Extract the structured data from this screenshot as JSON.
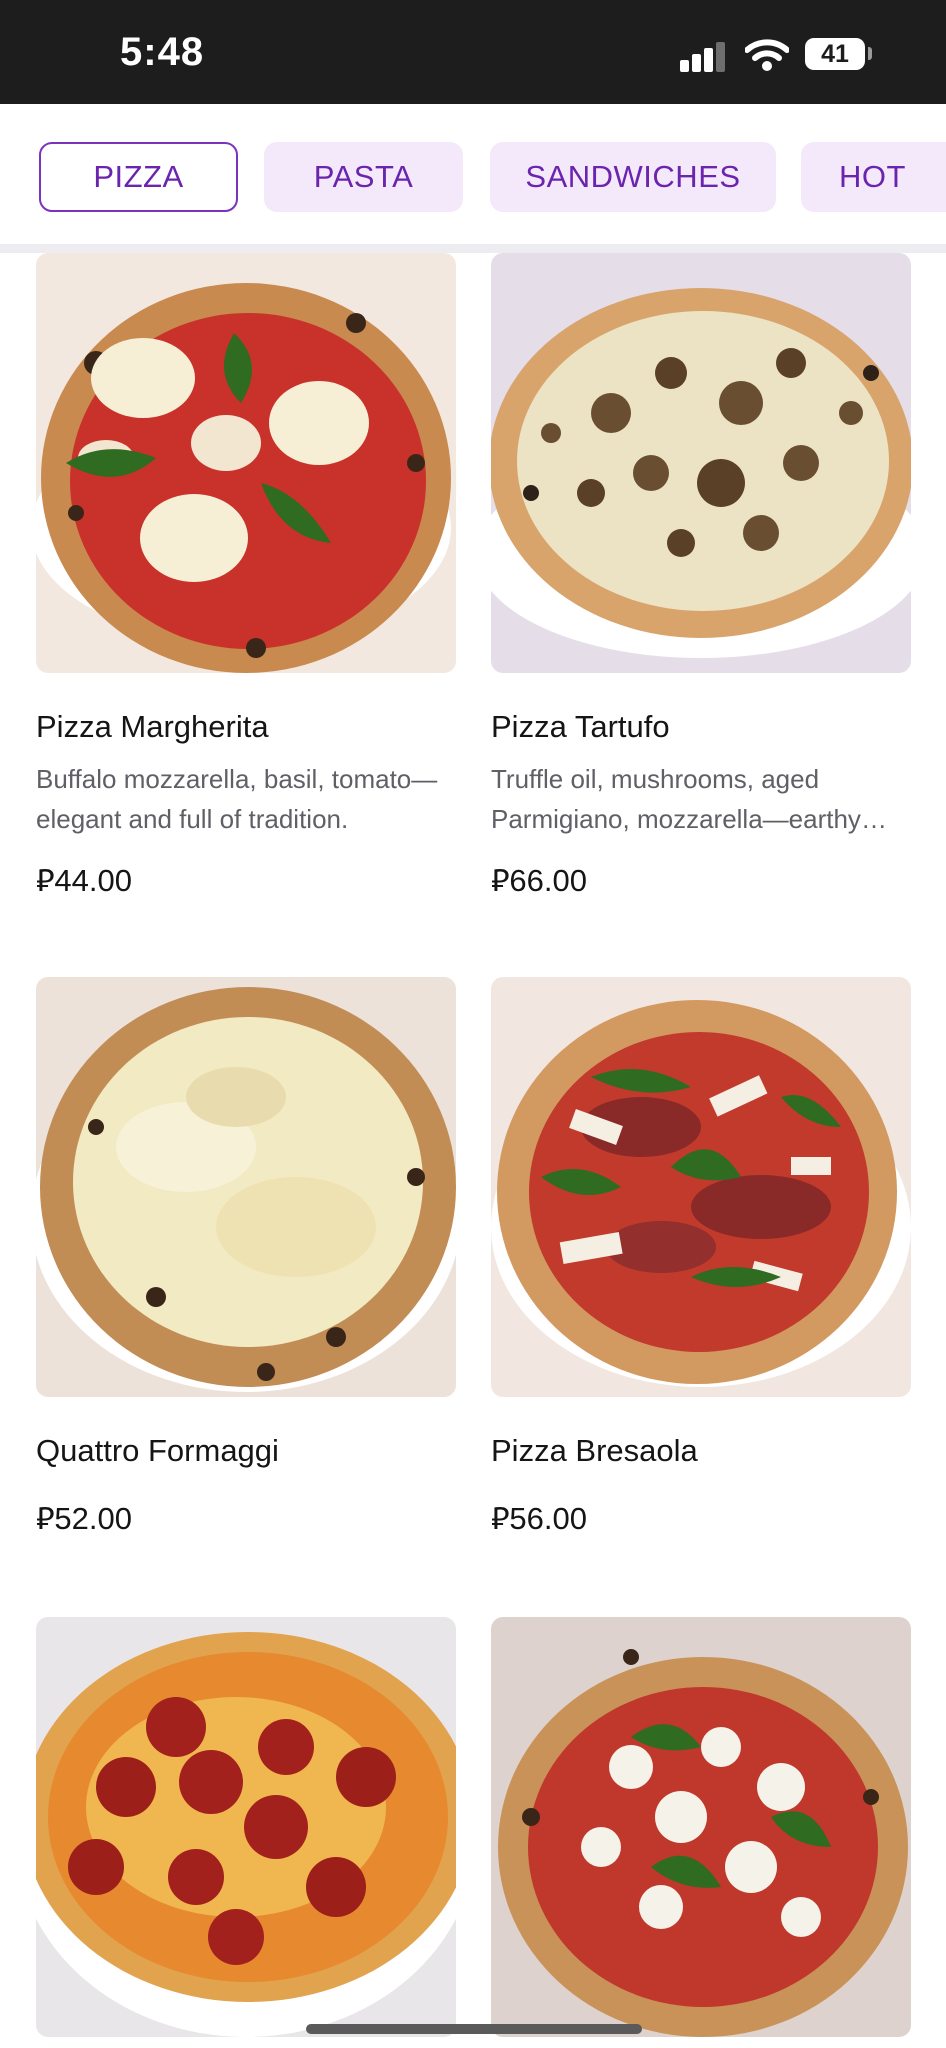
{
  "status_bar": {
    "time": "5:48",
    "battery": "41"
  },
  "tabs": [
    {
      "label": "PIZZA",
      "active": true
    },
    {
      "label": "PASTA",
      "active": false
    },
    {
      "label": "SANDWICHES",
      "active": false
    },
    {
      "label": "HOT",
      "active": false
    }
  ],
  "colors": {
    "accent": "#6b24ad",
    "tab_background": "#f4e9fb",
    "status_bar": "#1d1d1d"
  },
  "products": [
    {
      "name": "Pizza Margherita",
      "description": "Buffalo mozzarella, basil, tomato—elegant and full of tradition.",
      "price": "⃁44.00",
      "image": "pizza-margherita-photo"
    },
    {
      "name": "Pizza Tartufo",
      "description": "Truffle oil, mushrooms, aged Parmigiano, mozzarella—earthy and rich.",
      "price": "⃁66.00",
      "image": "pizza-tartufo-photo"
    },
    {
      "name": "Quattro Formaggi",
      "description": "",
      "price": "⃁52.00",
      "image": "quattro-formaggi-photo"
    },
    {
      "name": "Pizza Bresaola",
      "description": "",
      "price": "⃁56.00",
      "image": "pizza-bresaola-photo"
    },
    {
      "name": "",
      "description": "",
      "price": "",
      "image": "pepperoni-pizza-photo"
    },
    {
      "name": "",
      "description": "",
      "price": "",
      "image": "burrata-pizza-photo"
    }
  ]
}
